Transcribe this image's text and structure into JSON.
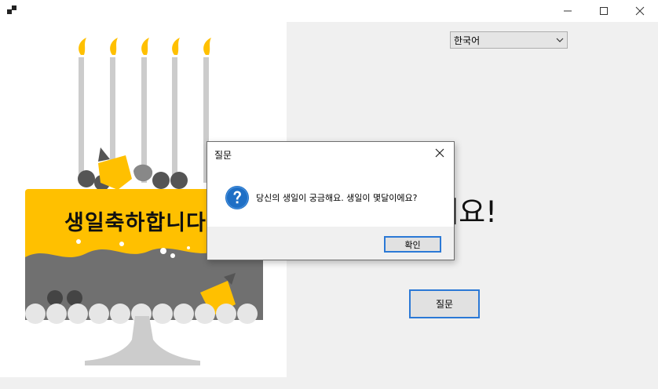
{
  "window": {
    "icon": "app-icon",
    "controls": {
      "minimize": "minimize-icon",
      "maximize": "maximize-icon",
      "close": "close-icon"
    }
  },
  "cake": {
    "text": "생일축하합니다"
  },
  "language_select": {
    "value": "한국어"
  },
  "greeting": {
    "text": "복하세요!"
  },
  "ask_button": {
    "label": "질문"
  },
  "dialog": {
    "title": "질문",
    "message": "당신의 생일이 궁금해요. 생일이 몇달이에요?",
    "ok_label": "확인",
    "icon": "question-icon"
  },
  "colors": {
    "cake_yellow": "#ffc000",
    "accent_blue": "#2b79d6",
    "cake_gray": "#707070"
  }
}
